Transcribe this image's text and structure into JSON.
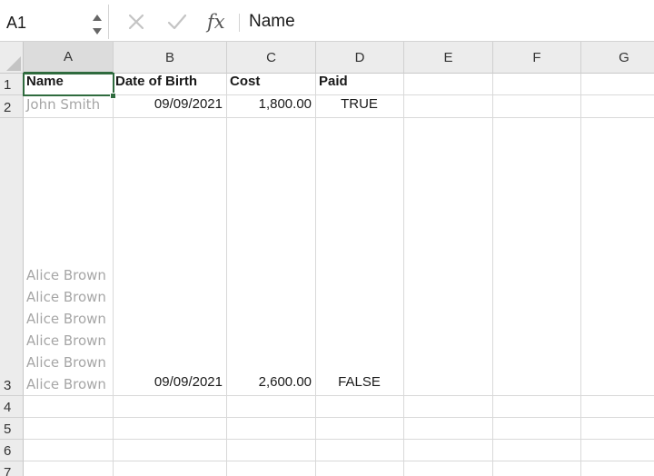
{
  "formula_bar": {
    "name_box": "A1",
    "cancel_icon": "x-icon",
    "confirm_icon": "check-icon",
    "fx_label": "fx",
    "content": "Name"
  },
  "columns": [
    "A",
    "B",
    "C",
    "D",
    "E",
    "F",
    "G"
  ],
  "rows": [
    "1",
    "2",
    "3",
    "4",
    "5",
    "6",
    "7"
  ],
  "cells": {
    "A1": "Name",
    "B1": "Date of Birth",
    "C1": "Cost",
    "D1": "Paid",
    "A2": "John Smith",
    "B2": "09/09/2021",
    "C2": "1,800.00",
    "D2": "TRUE",
    "A3": "Alice Brown\nAlice Brown\nAlice Brown\nAlice Brown\nAlice Brown\nAlice Brown",
    "B3": "09/09/2021",
    "C3": "2,600.00",
    "D3": "FALSE"
  },
  "selected_cell": "A1",
  "colors": {
    "selection": "#2f6b3e",
    "header_bg": "#ececec",
    "muted_text": "#a6a6a6"
  }
}
